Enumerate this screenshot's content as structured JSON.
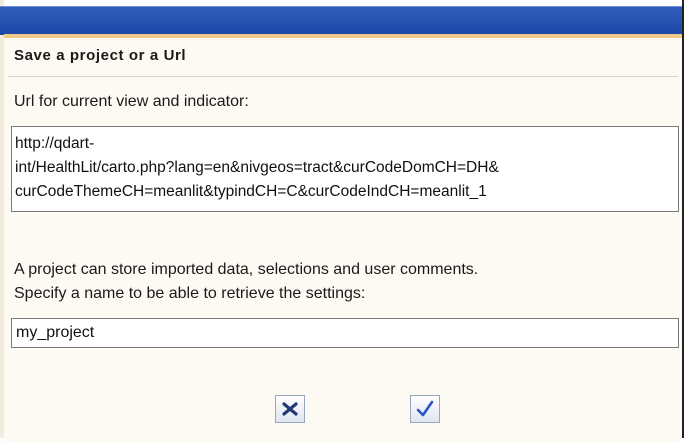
{
  "dialog": {
    "title": "Save a project or a Url",
    "url_label": "Url for current view and indicator:",
    "url_value": "http://qdart-\nint/HealthLit/carto.php?lang=en&nivgeos=tract&curCodeDomCH=DH&\ncurCodeThemeCH=meanlit&typindCH=C&curCodeIndCH=meanlit_1",
    "description_line1": "A project can store imported data, selections and user comments.",
    "description_line2": "Specify a name to be able to retrieve the settings:",
    "project_name_value": "my_project"
  },
  "buttons": {
    "cancel_icon": "close-icon",
    "confirm_icon": "checkmark-icon"
  },
  "colors": {
    "title_bar": "#1d47a8",
    "dialog_top_border": "#f3c98a",
    "cancel_icon": "#223a73",
    "confirm_icon": "#2a56c6"
  }
}
